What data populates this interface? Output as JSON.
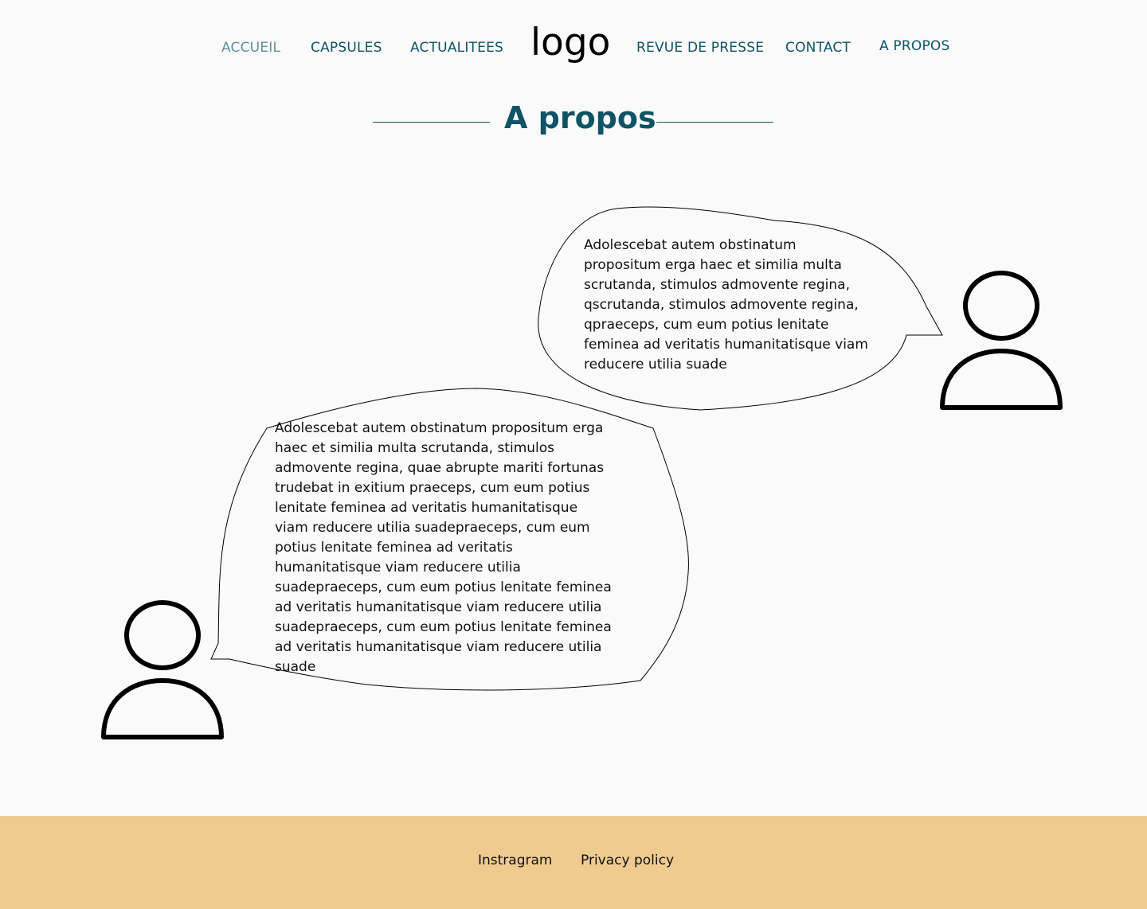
{
  "nav": {
    "items": [
      {
        "label": "ACCUEIL"
      },
      {
        "label": "CAPSULES"
      },
      {
        "label": "ACTUALITEES"
      },
      {
        "label": "REVUE DE PRESSE"
      },
      {
        "label": "CONTACT"
      },
      {
        "label": "A PROPOS"
      }
    ],
    "logo": "logo"
  },
  "page": {
    "title": "A propos"
  },
  "bubbles": [
    {
      "text": "Adolescebat autem obstinatum propositum erga haec et similia multa scrutanda, stimulos admovente regina, qscrutanda, stimulos admovente regina, qpraeceps, cum eum potius lenitate feminea ad veritatis humanitatisque viam reducere utilia suade"
    },
    {
      "text": "Adolescebat autem obstinatum propositum erga haec et similia multa scrutanda, stimulos admovente regina, quae abrupte mariti fortunas trudebat in exitium praeceps, cum eum potius lenitate feminea ad veritatis humanitatisque viam reducere utilia suadepraeceps, cum eum potius lenitate feminea ad veritatis humanitatisque viam reducere utilia suadepraeceps, cum eum potius lenitate feminea ad veritatis humanitatisque viam reducere utilia suadepraeceps, cum eum potius lenitate feminea ad veritatis humanitatisque viam reducere utilia suade"
    }
  ],
  "footer": {
    "links": [
      {
        "label": "Instragram"
      },
      {
        "label": "Privacy policy"
      }
    ]
  },
  "colors": {
    "accent": "#0e5366",
    "muted_link": "#5d8f9c",
    "footer_bg": "#f0cb90",
    "background": "#fafafa"
  }
}
